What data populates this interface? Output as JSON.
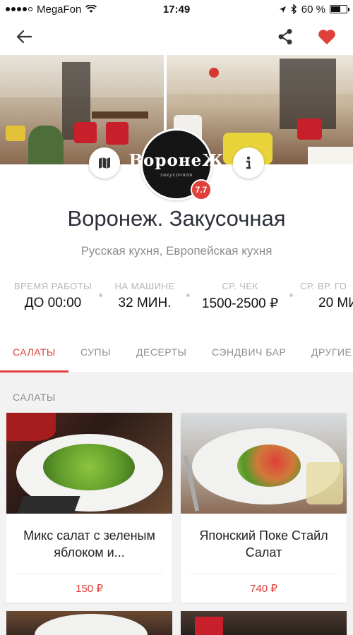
{
  "status_bar": {
    "carrier": "MegaFon",
    "time": "17:49",
    "battery_text": "60 %",
    "battery_level": 0.6
  },
  "nav": {
    "back_icon": "arrow-left-icon",
    "share_icon": "share-icon",
    "favorite_icon": "heart-icon",
    "accent_color": "#e0403a"
  },
  "restaurant": {
    "logo_text": "ВоронеЖ",
    "logo_subtext": "закусочная",
    "rating": "7.7",
    "name": "Воронеж. Закусочная",
    "cuisine": "Русская кухня, Европейская кухня"
  },
  "info": [
    {
      "label": "ВРЕМЯ РАБОТЫ",
      "value": "ДО 00:00"
    },
    {
      "label": "НА МАШИНЕ",
      "value": "32 МИН."
    },
    {
      "label": "СР. ЧЕК",
      "value": "1500-2500 ₽"
    },
    {
      "label": "СР. ВР. ГО",
      "value": "20 МИ"
    }
  ],
  "tabs": [
    {
      "label": "САЛАТЫ",
      "active": true
    },
    {
      "label": "СУПЫ",
      "active": false
    },
    {
      "label": "ДЕСЕРТЫ",
      "active": false
    },
    {
      "label": "СЭНДВИЧ БАР",
      "active": false
    },
    {
      "label": "ДРУГИЕ",
      "active": false
    }
  ],
  "section": {
    "title": "САЛАТЫ"
  },
  "dishes": [
    {
      "name": "Микс салат с зеленым яблоком и...",
      "price": "150 ₽"
    },
    {
      "name": "Японский Поке Стайл Салат",
      "price": "740 ₽"
    }
  ]
}
